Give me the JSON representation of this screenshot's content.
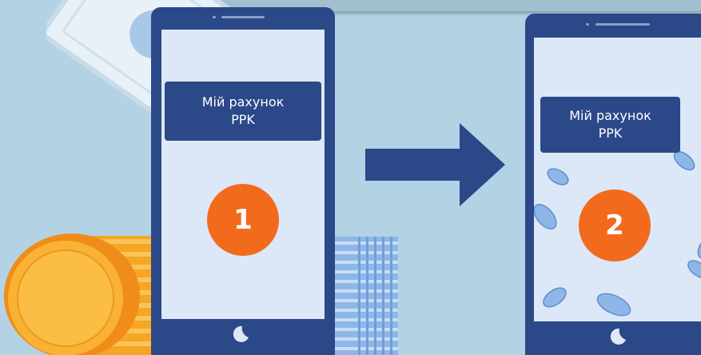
{
  "colors": {
    "background": "#b3d2e3",
    "phone_body": "#2b4888",
    "screen": "#dce8f7",
    "badge": "#f26b1d",
    "coin_gold": "#f9b233",
    "coin_blue": "#8fb6e8"
  },
  "phone_before": {
    "account_label_line1": "Мій рахунок",
    "account_label_line2": "PPK",
    "step_number": "1"
  },
  "phone_after": {
    "account_label_line1": "Мій рахунок",
    "account_label_line2": "PPK",
    "step_number": "2"
  },
  "icons": {
    "arrow": "arrow-right-icon",
    "home": "home-button-icon",
    "banknote": "banknote-icon",
    "coins": "coin-stack-icon"
  }
}
